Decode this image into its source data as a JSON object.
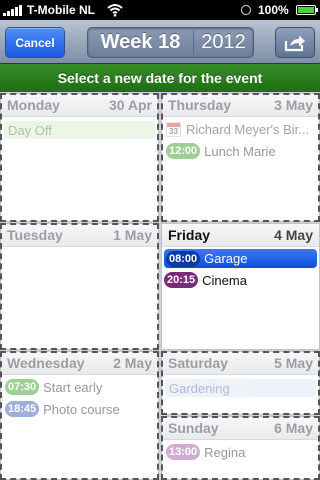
{
  "status_bar": {
    "carrier": "T-Mobile NL",
    "battery_percent": "100%"
  },
  "nav": {
    "cancel_label": "Cancel",
    "week_label": "Week 18",
    "year_label": "2012",
    "share_icon": "share-icon"
  },
  "banner": {
    "text": "Select a new date for the event"
  },
  "days": {
    "monday": {
      "name": "Monday",
      "date": "30 Apr",
      "allday": "Day Off"
    },
    "thursday": {
      "name": "Thursday",
      "date": "3 May",
      "birthday_icon_number": "33",
      "birthday": "Richard Meyer's Bir...",
      "event_time": "12:00",
      "event_title": "Lunch Marie"
    },
    "tuesday": {
      "name": "Tuesday",
      "date": "1 May"
    },
    "friday": {
      "name": "Friday",
      "date": "4 May",
      "selected_time": "08:00",
      "selected_title": "Garage",
      "event_time": "20:15",
      "event_title": "Cinema"
    },
    "wednesday": {
      "name": "Wednesday",
      "date": "2 May",
      "event1_time": "07:30",
      "event1_title": "Start early",
      "event2_time": "18:45",
      "event2_title": "Photo course"
    },
    "saturday": {
      "name": "Saturday",
      "date": "5 May",
      "allday": "Gardening"
    },
    "sunday": {
      "name": "Sunday",
      "date": "6 May",
      "event_time": "13:00",
      "event_title": "Regina"
    }
  },
  "colors": {
    "green_pill": "#4fa83d",
    "blue_pill": "#4d6fc2",
    "purple_pill": "#7a2a7a",
    "lavender_pill": "#b06ab0",
    "dayoff_bg": "#dcefd5",
    "gardening_bg": "#dfe9f5"
  }
}
